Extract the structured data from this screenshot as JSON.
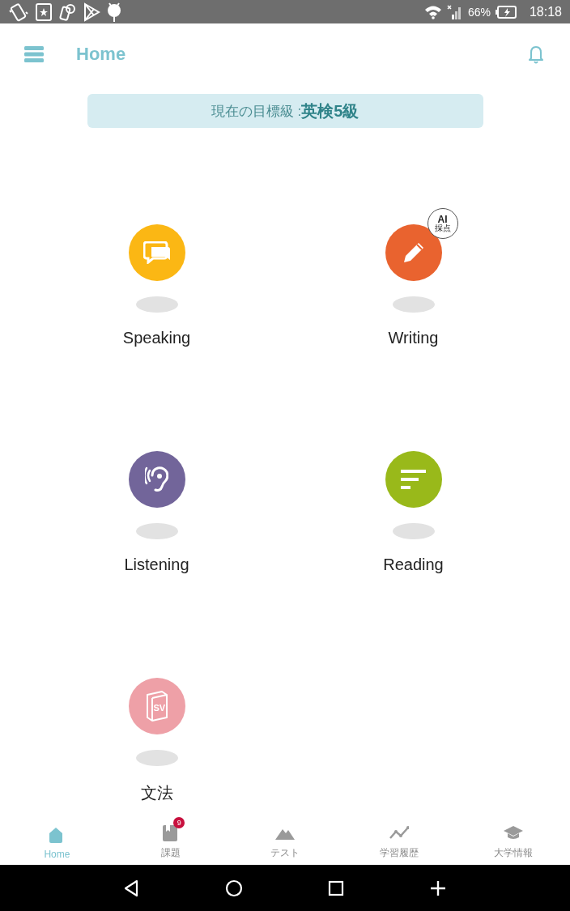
{
  "status_bar": {
    "battery": "66%",
    "time": "18:18"
  },
  "app_bar": {
    "title": "Home"
  },
  "target_banner": {
    "label": "現在の目標級 : ",
    "value": "英検5級"
  },
  "skills": [
    {
      "label": "Speaking",
      "kind": "speaking",
      "color": "#fbb714"
    },
    {
      "label": "Writing",
      "kind": "writing",
      "color": "#e9632f",
      "badge": {
        "line1": "AI",
        "line2": "採点"
      }
    },
    {
      "label": "Listening",
      "kind": "listening",
      "color": "#72659a"
    },
    {
      "label": "Reading",
      "kind": "reading",
      "color": "#99b91a"
    },
    {
      "label": "文法",
      "kind": "grammar",
      "color": "#eea0a7",
      "icon_text": "SV"
    }
  ],
  "bottom_nav": [
    {
      "label": "Home",
      "kind": "home",
      "selected": true
    },
    {
      "label": "課題",
      "kind": "tasks",
      "selected": false,
      "badge": "9"
    },
    {
      "label": "テスト",
      "kind": "test",
      "selected": false
    },
    {
      "label": "学習履歴",
      "kind": "history",
      "selected": false
    },
    {
      "label": "大学情報",
      "kind": "university",
      "selected": false
    }
  ]
}
